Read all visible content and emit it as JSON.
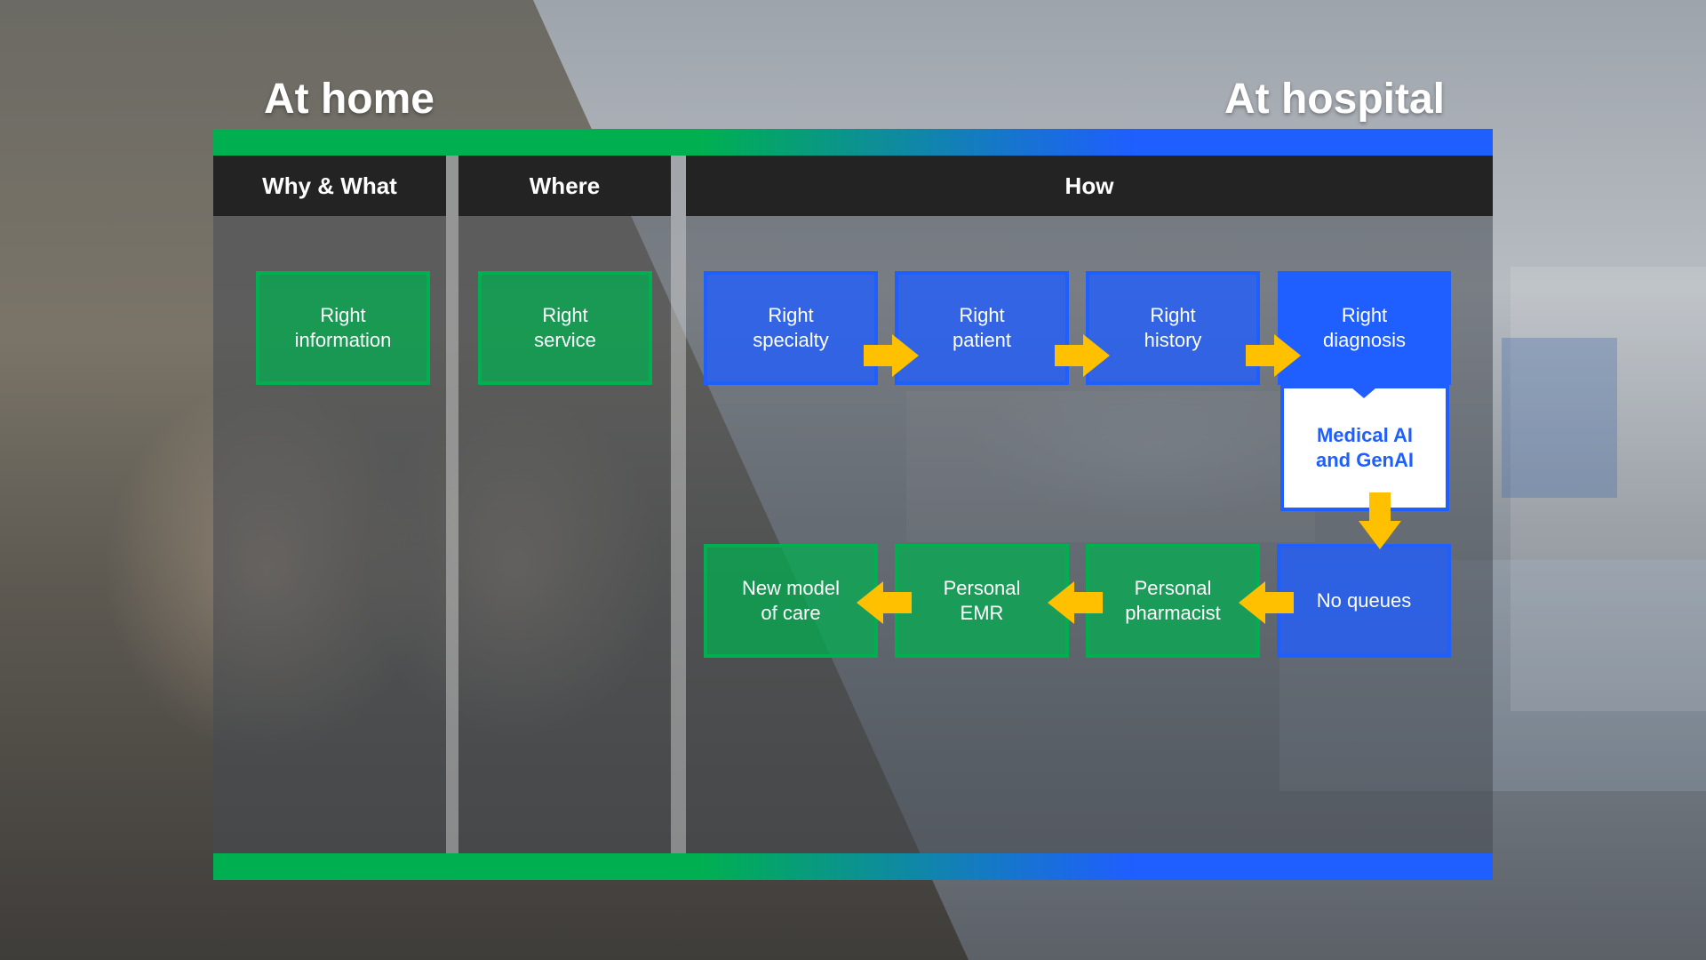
{
  "titles": {
    "left": "At home",
    "right": "At hospital"
  },
  "columns": {
    "why_what": "Why & What",
    "where": "Where",
    "how": "How"
  },
  "boxes": {
    "right_information": "Right\ninformation",
    "right_service": "Right\nservice",
    "right_specialty": "Right\nspecialty",
    "right_patient": "Right\npatient",
    "right_history": "Right\nhistory",
    "right_diagnosis": "Right\ndiagnosis",
    "medical_ai": "Medical AI\nand GenAI",
    "no_queues": "No queues",
    "personal_pharmacist": "Personal\npharmacist",
    "personal_emr": "Personal\nEMR",
    "new_model_of_care": "New model\nof care"
  },
  "colors": {
    "green": "#00b050",
    "blue": "#1f5eff",
    "arrow": "#ffc000",
    "header": "#232323"
  }
}
